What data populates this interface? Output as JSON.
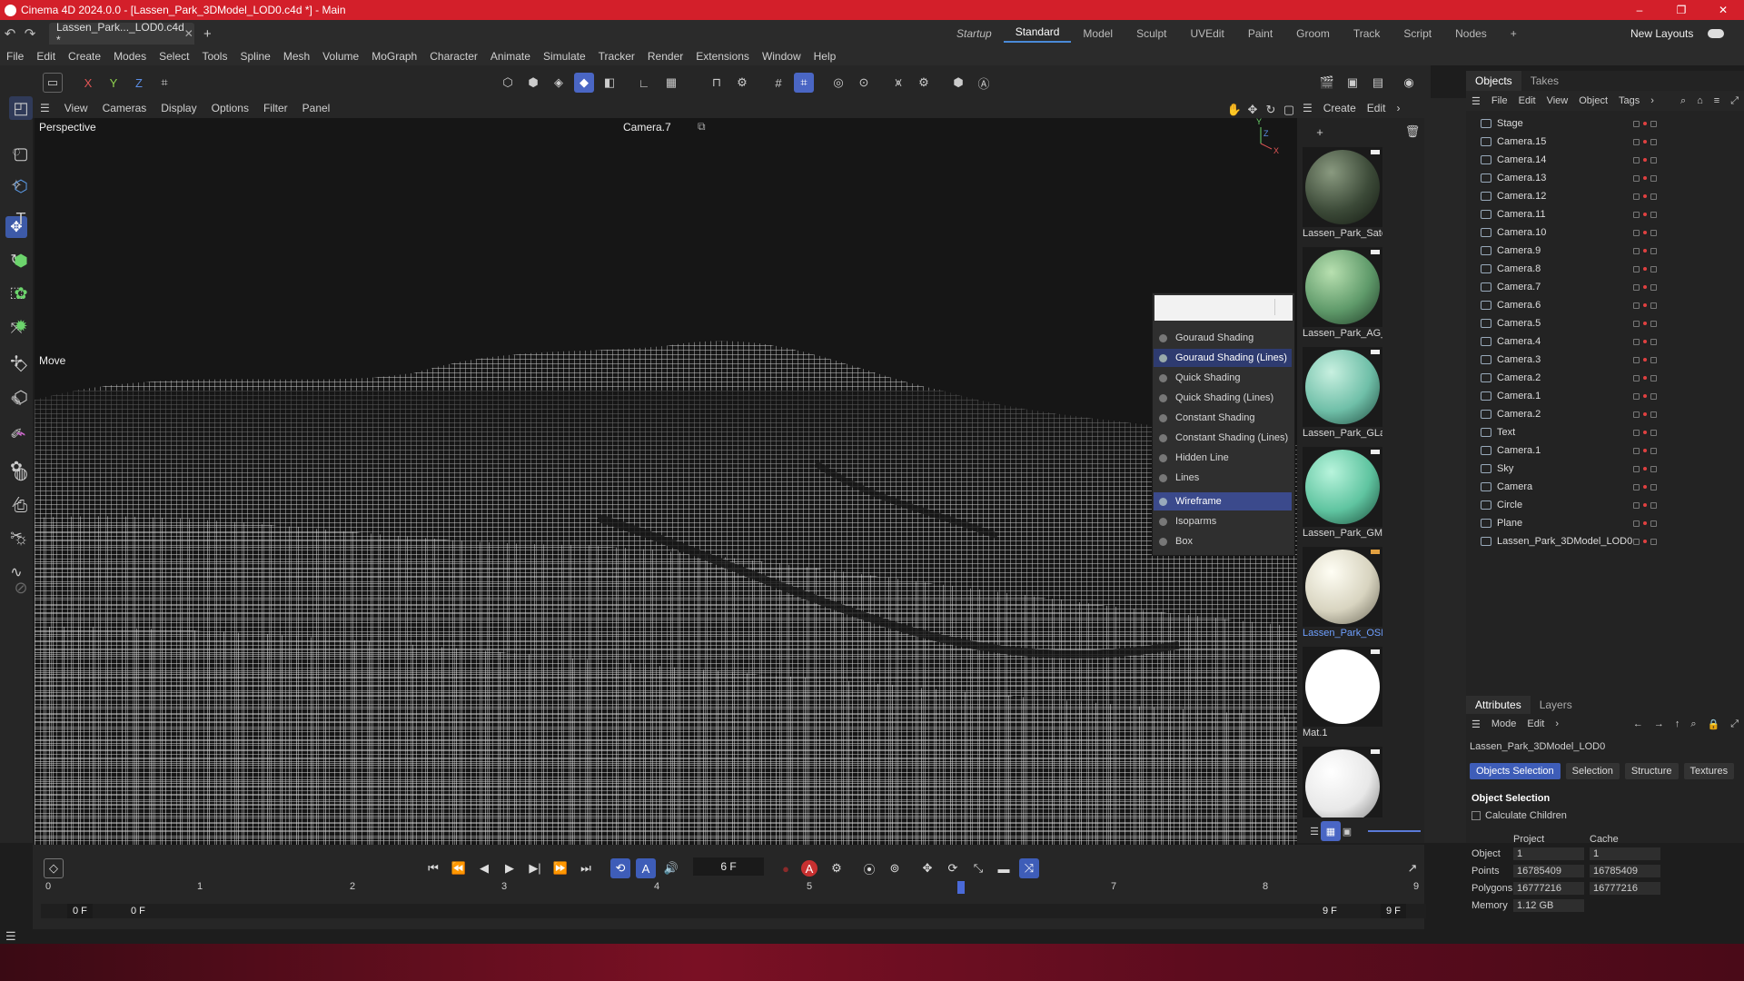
{
  "window": {
    "title": "Cinema 4D 2024.0.0 - [Lassen_Park_3DModel_LOD0.c4d *] - Main",
    "controls": [
      "–",
      "❐",
      "✕"
    ]
  },
  "tabbar": {
    "doc_tab": "Lassen_Park..._LOD0.c4d *",
    "close": "✕",
    "add": "+"
  },
  "layouts": {
    "items": [
      "Startup",
      "Standard",
      "Model",
      "Sculpt",
      "UVEdit",
      "Paint",
      "Groom",
      "Track",
      "Script",
      "Nodes"
    ],
    "active": "Standard",
    "add": "+",
    "new_layouts": "New Layouts"
  },
  "menubar": [
    "File",
    "Edit",
    "Create",
    "Modes",
    "Select",
    "Tools",
    "Spline",
    "Mesh",
    "Volume",
    "MoGraph",
    "Character",
    "Animate",
    "Simulate",
    "Tracker",
    "Render",
    "Extensions",
    "Window",
    "Help"
  ],
  "axis_buttons": [
    "X",
    "Y",
    "Z"
  ],
  "viewport": {
    "menu": [
      "View",
      "Cameras",
      "Display",
      "Options",
      "Filter",
      "Panel"
    ],
    "name": "Perspective",
    "camera": "Camera.7",
    "tool_label": "Move",
    "axis_y": "Y",
    "axis_z": "Z",
    "axis_x": "X"
  },
  "shading_menu": {
    "items": [
      "Gouraud Shading",
      "Gouraud Shading (Lines)",
      "Quick Shading",
      "Quick Shading (Lines)",
      "Constant Shading",
      "Constant Shading (Lines)",
      "Hidden Line",
      "Lines",
      "Wireframe",
      "Isoparms",
      "Box"
    ],
    "active_shading": "Gouraud Shading (Lines)",
    "active_line": "Wireframe"
  },
  "materials": {
    "menu": [
      "Create",
      "Edit"
    ],
    "items": [
      {
        "name": "Lassen_Park_Satel",
        "color": "#3c4a38"
      },
      {
        "name": "Lassen_Park_AG_L",
        "color": "#5f9a6a"
      },
      {
        "name": "Lassen_Park_GLan",
        "color": "#6fbfa8"
      },
      {
        "name": "Lassen_Park_GMa",
        "color": "#5fc4a0"
      },
      {
        "name": "Lassen_Park_OSM",
        "color": "#d8d4c0"
      },
      {
        "name": "Mat.1",
        "color": "#ffffff"
      },
      {
        "name": "",
        "color": "#e8e8e8"
      }
    ],
    "selected": "Lassen_Park_OSM"
  },
  "objects": {
    "tabs": [
      "Objects",
      "Takes"
    ],
    "menu": [
      "File",
      "Edit",
      "View",
      "Object",
      "Tags"
    ],
    "items": [
      "Stage",
      "Camera.15",
      "Camera.14",
      "Camera.13",
      "Camera.12",
      "Camera.11",
      "Camera.10",
      "Camera.9",
      "Camera.8",
      "Camera.7",
      "Camera.6",
      "Camera.5",
      "Camera.4",
      "Camera.3",
      "Camera.2",
      "Camera.1",
      "Camera.2",
      "Text",
      "Camera.1",
      "Sky",
      "Camera",
      "Circle",
      "Plane",
      "Lassen_Park_3DModel_LOD0"
    ]
  },
  "attributes": {
    "tabs": [
      "Attributes",
      "Layers"
    ],
    "menu": [
      "Mode",
      "Edit"
    ],
    "object_name": "Lassen_Park_3DModel_LOD0",
    "buttons": [
      "Objects Selection",
      "Selection",
      "Structure",
      "Textures"
    ],
    "section": "Object Selection",
    "checkbox": "Calculate Children",
    "col_project": "Project",
    "col_cache": "Cache",
    "rows": [
      {
        "label": "Object",
        "project": "1",
        "cache": "1"
      },
      {
        "label": "Points",
        "project": "16785409",
        "cache": "16785409"
      },
      {
        "label": "Polygons",
        "project": "16777216",
        "cache": "16777216"
      },
      {
        "label": "Memory",
        "project": "1.12 GB",
        "cache": ""
      }
    ]
  },
  "timeline": {
    "current_frame": "6 F",
    "ticks": [
      "0",
      "1",
      "2",
      "3",
      "4",
      "5",
      "6",
      "7",
      "8",
      "9"
    ],
    "range_start": "0 F",
    "range_start2": "0 F",
    "range_end": "9 F",
    "range_end2": "9 F",
    "playhead_frame": 6
  },
  "colors": {
    "accent": "#4a66c4",
    "title_bar": "#d31f2a"
  }
}
